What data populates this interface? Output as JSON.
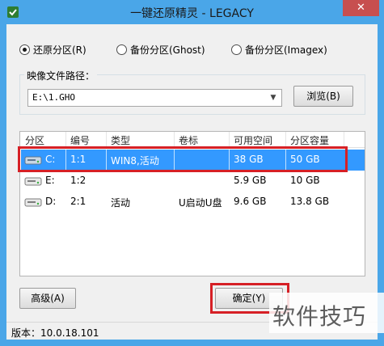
{
  "window": {
    "title": "一键还原精灵 - LEGACY",
    "close_label": "✕"
  },
  "mode": {
    "options": [
      {
        "label": "还原分区(R)",
        "checked": true
      },
      {
        "label": "备份分区(Ghost)",
        "checked": false
      },
      {
        "label": "备份分区(Imagex)",
        "checked": false
      }
    ]
  },
  "image_path": {
    "legend": "映像文件路径：",
    "value": "E:\\1.GHO",
    "browse_label": "浏览(B)"
  },
  "partition_table": {
    "headers": [
      "分区",
      "编号",
      "类型",
      "卷标",
      "可用空间",
      "分区容量"
    ],
    "rows": [
      {
        "drive": "C:",
        "number": "1:1",
        "type": "WIN8,活动",
        "label": "",
        "free": "38 GB",
        "capacity": "50 GB",
        "selected": true
      },
      {
        "drive": "E:",
        "number": "1:2",
        "type": "",
        "label": "",
        "free": "5.9 GB",
        "capacity": "10 GB",
        "selected": false
      },
      {
        "drive": "D:",
        "number": "2:1",
        "type": "活动",
        "label": "U启动U盘",
        "free": "9.6 GB",
        "capacity": "13.8 GB",
        "selected": false
      }
    ]
  },
  "buttons": {
    "advanced_label": "高级(A)",
    "ok_label": "确定(Y)"
  },
  "status": {
    "version": "版本：10.0.18.101"
  },
  "watermark": {
    "text": "软件技巧"
  },
  "colors": {
    "titlebar": "#4aa6e8",
    "selection": "#3399ff",
    "highlight": "#d62026",
    "close": "#c74f4f"
  }
}
